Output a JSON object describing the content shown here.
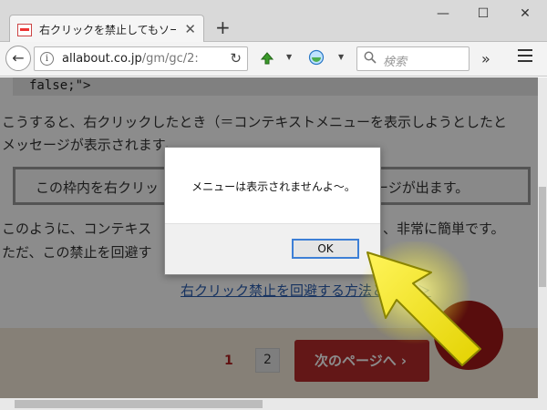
{
  "window": {
    "tab_title": "右クリックを禁止してもソース...",
    "tab_close": "✕",
    "new_tab": "+",
    "minimize": "—",
    "maximize": "☐",
    "close": "✕"
  },
  "navbar": {
    "back": "←",
    "url_host": "allabout.co.jp",
    "url_path": "/gm/gc/2:",
    "reload": "↻",
    "search_placeholder": "検索",
    "overflow": "»"
  },
  "page": {
    "code_line": "false;\">",
    "para1": "こうすると、右クリックしたとき（＝コンテキストメニューを表示しようとしたと",
    "para2": "メッセージが表示されます。",
    "box_text_left": "この枠内を右クリッ",
    "box_text_right": "ージが出ます。",
    "para3_left": "このように、コンテキス",
    "para3_right": "、非常に簡単です。",
    "para4": "ただ、この禁止を回避す",
    "link_text": "右クリック禁止を回避する方法とは？ ＞",
    "pager_1": "1",
    "pager_2": "2",
    "next_button": "次のページへ ›"
  },
  "dialog": {
    "message": "メニューは表示されませんよ～。",
    "ok": "OK"
  },
  "colors": {
    "accent_red": "#b42a2a",
    "link_blue": "#2a5db0",
    "annotation_yellow": "#f2e81a"
  }
}
